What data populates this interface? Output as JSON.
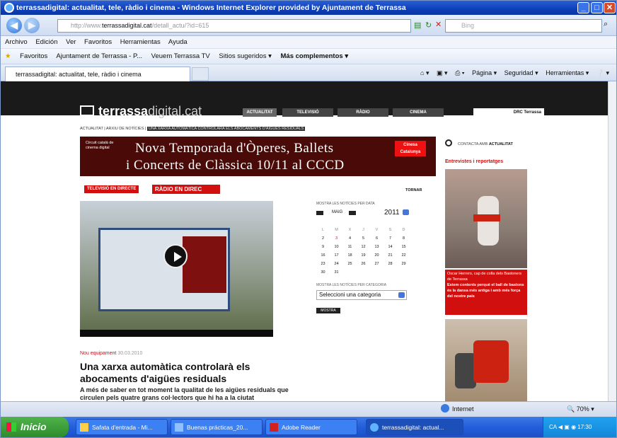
{
  "window": {
    "title": "terrassadigital: actualitat, tele, ràdio i cinema - Windows Internet Explorer provided by Ajuntament de Terrassa"
  },
  "address": {
    "url_prefix": "http://www.",
    "url_domain": "terrassadigital.cat",
    "url_suffix": "/detall_actu/?id=615",
    "search_placeholder": "Bing"
  },
  "menu": [
    "Archivo",
    "Edición",
    "Ver",
    "Favoritos",
    "Herramientas",
    "Ayuda"
  ],
  "favorites": {
    "label": "Favoritos",
    "items": [
      "Ajuntament de Terrassa - P...",
      "Veuem Terrassa TV",
      "Sitios sugeridos ▾",
      "Más complementos ▾"
    ]
  },
  "tab": {
    "title": "terrassadigital: actualitat, tele, ràdio i cinema"
  },
  "commands": [
    "Página ▾",
    "Seguridad ▾",
    "Herramientas ▾"
  ],
  "site": {
    "logo_bold": "terrassa",
    "logo_thin": "digital.cat",
    "nav": [
      "ACTUALITAT",
      "TELEVISIÓ",
      "RÀDIO",
      "CINEMA"
    ],
    "nav_right": "DRC Terrassa",
    "breadcrumb_a": "ACTUALITAT | ARXIU DE NOTÍCIES | ",
    "breadcrumb_b": "UNA XARXA AUTOMÀTICA CONTROLARÀ ELS ABOCAMENTS D'AIGÜES RESIDUALS",
    "banner_left": "Circuit català de cinema digital",
    "banner_line1": "Nova Temporada d'Òperes, Ballets",
    "banner_line2": "i Concerts de Clàssica 10/11 al CCCD",
    "banner_badge": "Cinesa Catalunya",
    "tv_button": "TELEVISIÓ EN DIRECTE",
    "radio_button": "RÀDIO EN DIREC",
    "tornar": "TORNAR",
    "article_category": "Nou equipament",
    "article_date": "30.03.2010",
    "headline": "Una xarxa automàtica controlarà els abocaments d'aigües residuals",
    "lead": "A més de saber en tot moment la qualitat de les aigües residuals que circulen pels quatre grans col·lectors que hi ha a la ciutat",
    "cal_label": "MOSTRA LES NOTÍCIES PER DATA",
    "cal_month": "MAIG",
    "cal_year": "2011",
    "cal_days": [
      "L",
      "M",
      "X",
      "J",
      "V",
      "S",
      "D"
    ],
    "cal_weeks": [
      [
        "2",
        "3",
        "4",
        "5",
        "6",
        "7",
        "8"
      ],
      [
        "9",
        "10",
        "11",
        "12",
        "13",
        "14",
        "15"
      ],
      [
        "16",
        "17",
        "18",
        "19",
        "20",
        "21",
        "22"
      ],
      [
        "23",
        "24",
        "25",
        "26",
        "27",
        "28",
        "29"
      ],
      [
        "30",
        "31",
        "",
        "",
        "",
        "",
        ""
      ]
    ],
    "cat_label": "MOSTRA LES NOTÍCIES PER CATEGORIA",
    "cat_select": "Seleccioni una categoria",
    "mostra_btn": "MOSTRA",
    "contact_a": "CONTACTA AMB ",
    "contact_b": "ACTUALITAT",
    "entrevistes": "Entrevistes i reportatges",
    "caption_name": "Oscar Herrero, cap de colla dels Bastoners de Terrassa",
    "caption_text": "Estem contents perquè el ball de bastons és la dansa més antiga i amb més força del nostre país"
  },
  "status": {
    "zone": "Internet",
    "zoom": "70%"
  },
  "taskbar": {
    "start": "Inicio",
    "tasks": [
      "Safata d'entrada - Mi...",
      "Buenas prácticas_20...",
      "Adobe Reader",
      "terrassadigital: actual..."
    ],
    "tray_lang": "CA",
    "clock": "17:30"
  }
}
